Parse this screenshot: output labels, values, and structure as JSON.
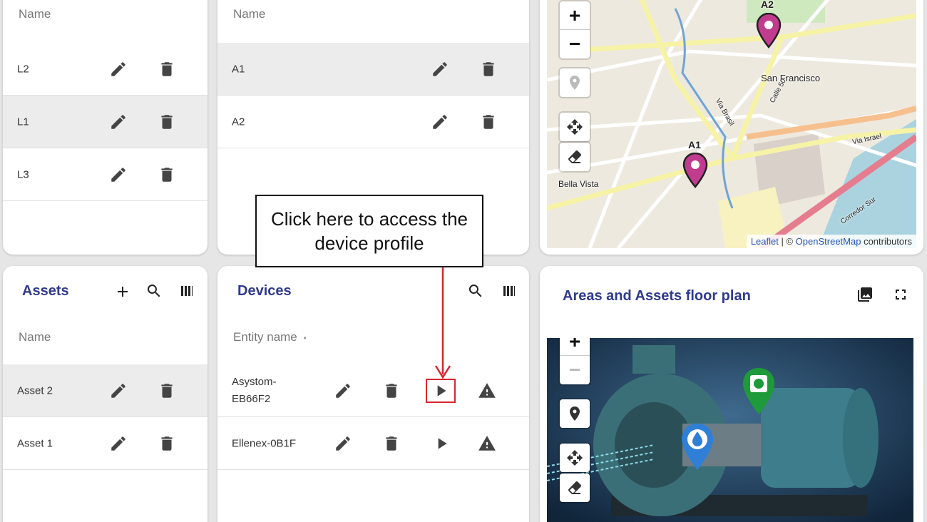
{
  "locations_card": {
    "column_header": "Name",
    "rows": [
      {
        "name": "L2",
        "selected": false
      },
      {
        "name": "L1",
        "selected": true
      },
      {
        "name": "L3",
        "selected": false
      }
    ]
  },
  "areas_card": {
    "column_header": "Name",
    "rows": [
      {
        "name": "A1",
        "selected": true
      },
      {
        "name": "A2",
        "selected": false
      }
    ]
  },
  "map": {
    "zoom_in": "+",
    "zoom_out": "−",
    "labels": {
      "san_francisco": "San Francisco",
      "bella_vista": "Bella Vista",
      "via_israel": "Via Israel",
      "via_brasil": "Via Brasil",
      "calle_50": "Calle 50",
      "corredor_sur": "Corredor Sur"
    },
    "markers": [
      {
        "label": "A2"
      },
      {
        "label": "A1"
      }
    ],
    "attribution": {
      "leaflet": "Leaflet",
      "separator": " | © ",
      "osm": "OpenStreetMap",
      "suffix": " contributors"
    },
    "colors": {
      "marker": "#c13c8e"
    }
  },
  "assets_card": {
    "title": "Assets",
    "column_header": "Name",
    "rows": [
      {
        "name": "Asset 2",
        "selected": true
      },
      {
        "name": "Asset 1",
        "selected": false
      }
    ]
  },
  "devices_card": {
    "title": "Devices",
    "column_header": "Entity name",
    "sort_indicator": "•",
    "rows": [
      {
        "name": "Asystom-\nEB66F2",
        "selected": false
      },
      {
        "name": "Ellenex-0B1F",
        "selected": false
      }
    ]
  },
  "floorplan_card": {
    "title": "Areas and Assets floor plan",
    "zoom_in": "+",
    "zoom_out": "−"
  },
  "callout": {
    "text": "Click here to access the device profile",
    "highlight_color": "#d8262f"
  },
  "colors": {
    "title": "#2f3a8f",
    "selected_row": "#ececec"
  }
}
